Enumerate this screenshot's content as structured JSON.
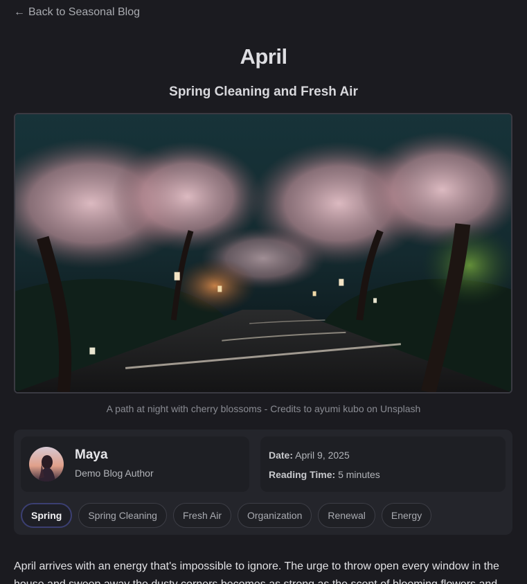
{
  "nav": {
    "back_label": "Back to Seasonal Blog",
    "back_icon": "arrow-left-icon"
  },
  "post": {
    "title": "April",
    "subtitle": "Spring Cleaning and Fresh Air",
    "image_caption": "A path at night with cherry blossoms - Credits to ayumi kubo on Unsplash"
  },
  "author": {
    "name": "Maya",
    "role": "Demo Blog Author"
  },
  "meta": {
    "date_label": "Date:",
    "date_value": "April 9, 2025",
    "reading_label": "Reading Time:",
    "reading_value": "5 minutes"
  },
  "tags": [
    "Spring",
    "Spring Cleaning",
    "Fresh Air",
    "Organization",
    "Renewal",
    "Energy"
  ],
  "active_tag": "Spring",
  "body": {
    "first_paragraph": "April arrives with an energy that's impossible to ignore. The urge to throw open every window in the house and sweep away the dusty corners becomes as strong as the scent of blooming flowers and"
  },
  "colors": {
    "background": "#1b1b20",
    "panel": "#24252b",
    "card": "#1e1f24",
    "active_tag_border": "#3b3f72"
  }
}
